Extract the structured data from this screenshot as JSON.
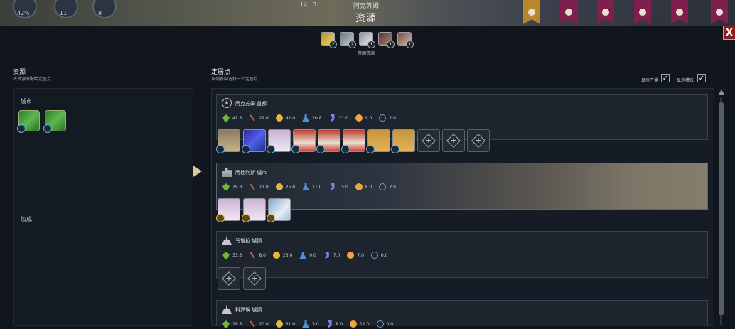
{
  "top": {
    "city_name": "阿克苏姆",
    "panel_title": "资源",
    "stat_left": "42%",
    "stat_2": "11",
    "stat_3": "8",
    "turn_a": "14",
    "turn_b": "3"
  },
  "close_label": "X",
  "empire_resources": {
    "items": [
      {
        "icon": "gold-resource-icon",
        "count": "2"
      },
      {
        "icon": "silver-resource-icon",
        "count": "2"
      },
      {
        "icon": "marble-resource-icon",
        "count": "1"
      },
      {
        "icon": "iron-resource-icon",
        "count": "1"
      },
      {
        "icon": "horse-resource-icon",
        "count": "1"
      }
    ],
    "label": "帝国资源"
  },
  "left": {
    "title": "资源",
    "subtitle": "将资源分配给定居点",
    "city_section": "城市",
    "bonus_section": "加成"
  },
  "right": {
    "title": "定居点",
    "subtitle": "从列表中选择一个定居点",
    "show_yield_label": "显示产量",
    "show_slots_label": "显示槽位"
  },
  "settlements": [
    {
      "name": "阿克苏姆 首都",
      "type": "capital",
      "stats": [
        "41.3",
        "29.0",
        "42.0",
        "20.8",
        "21.0",
        "9.0",
        "2.0"
      ]
    },
    {
      "name": "阿杜利斯 城市",
      "type": "city",
      "stats": [
        "29.3",
        "27.0",
        "25.0",
        "11.0",
        "15.0",
        "8.0",
        "2.0"
      ]
    },
    {
      "name": "马塔拉 城镇",
      "type": "town",
      "stats": [
        "33.3",
        "8.0",
        "23.0",
        "0.0",
        "7.0",
        "7.0",
        "0.0"
      ]
    },
    {
      "name": "科罗埃 城镇",
      "type": "town",
      "stats": [
        "18.8",
        "20.0",
        "31.0",
        "3.0",
        "8.0",
        "11.0",
        "0.0"
      ]
    }
  ],
  "colors": {
    "accent_gold": "#e5b93a",
    "close_red": "#8c1d1d",
    "panel_bg": "#161c25"
  }
}
